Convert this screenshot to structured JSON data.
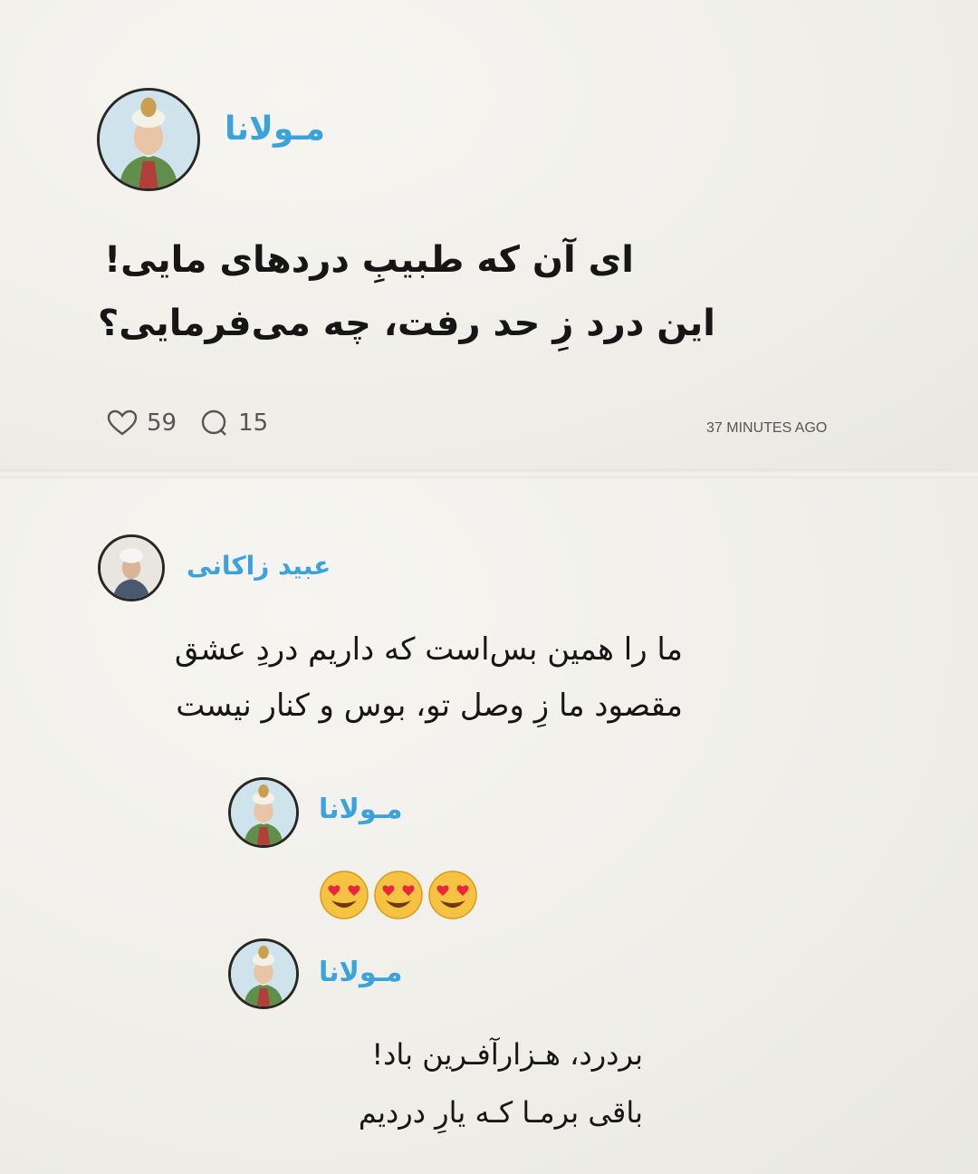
{
  "post": {
    "author": "مـولانا",
    "lines": [
      "ای آن که طبیبِ دردهای مایی!",
      "این درد زِ حد رفت، چه می‌فرمایی؟"
    ],
    "likes": "59",
    "comments": "15",
    "time": "37 MINUTES AGO"
  },
  "replies": [
    {
      "author": "عبید زاکانی",
      "lines": [
        "ما را همین بس‌است که داریم دردِ عشق",
        "مقصود ما زِ وصل تو، بوس و کنار نیست"
      ]
    },
    {
      "author": "مـولانا",
      "emojis": [
        "heart-eyes-face",
        "heart-eyes-face",
        "heart-eyes-face"
      ]
    },
    {
      "author": "مـولانا",
      "lines": [
        "بردرد، هـزارآفـرین باد!",
        "باقی برمـا کـه یارِ دردیم"
      ]
    }
  ],
  "colors": {
    "name": "#3aa3dc",
    "emoji_face": "#f5c242",
    "emoji_heart": "#e8273c"
  }
}
